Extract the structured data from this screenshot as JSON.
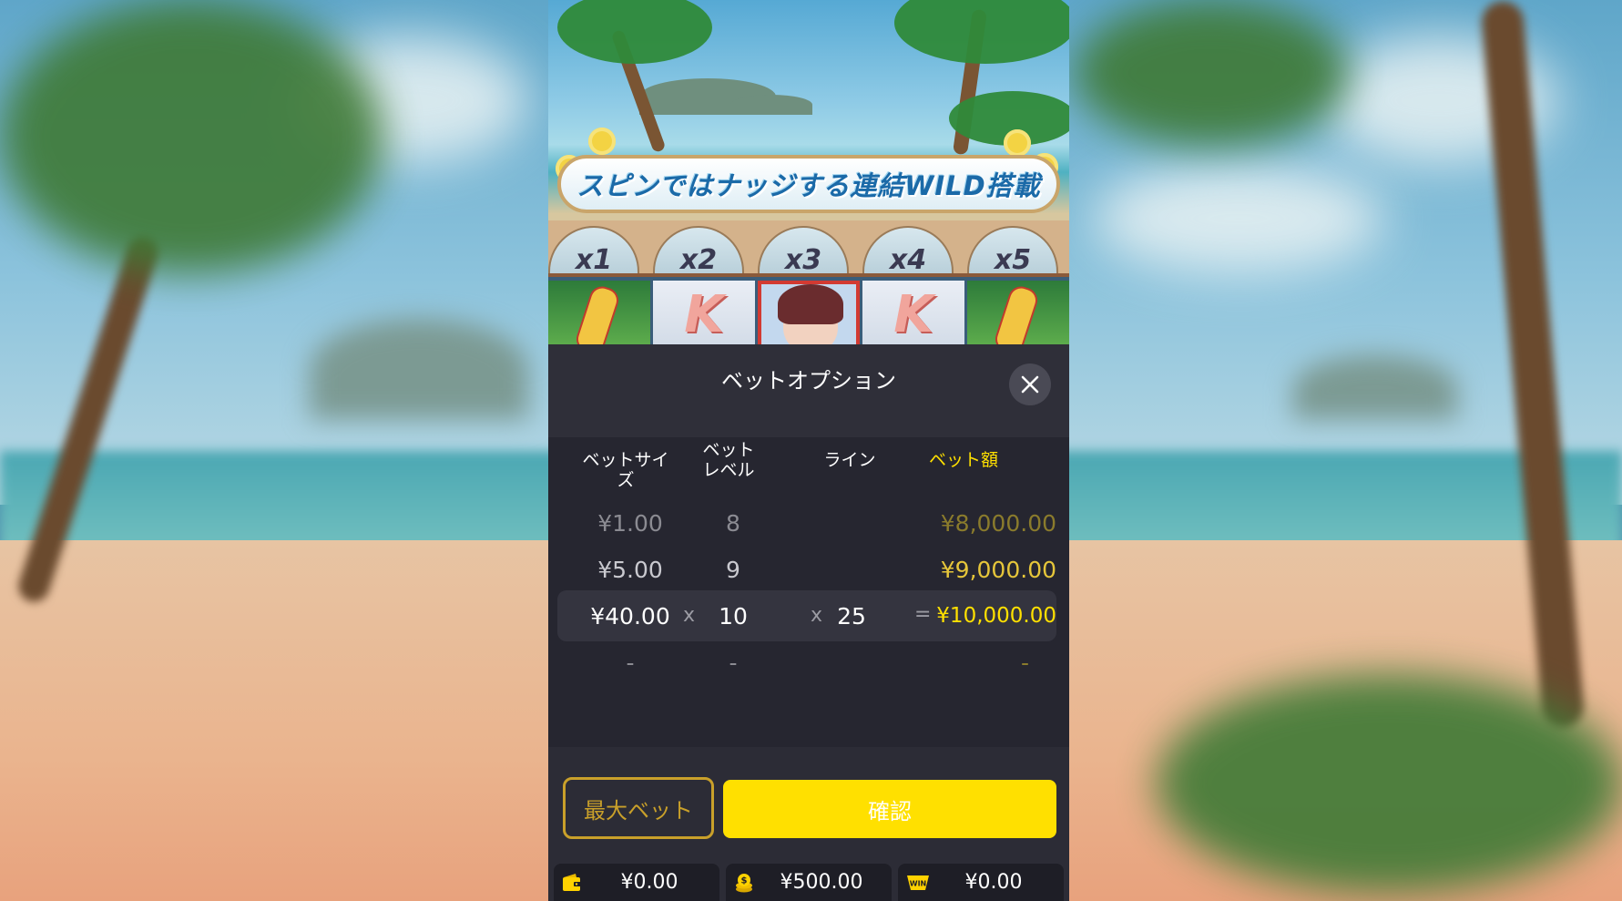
{
  "scene": {
    "banner_text": "スピンではナッジする連結WILD搭載",
    "multipliers": [
      "x1",
      "x2",
      "x3",
      "x4",
      "x5"
    ],
    "reel_letters": [
      "K",
      "K"
    ]
  },
  "panel": {
    "title": "ベットオプション",
    "columns": {
      "bet_size": "ベットサイズ",
      "bet_level_line1": "ベット",
      "bet_level_line2": "レベル",
      "lines": "ライン",
      "bet_amount": "ベット額"
    },
    "rows": [
      {
        "bet_size": "¥1.00",
        "bet_level": "8",
        "bet_amount": "¥8,000.00"
      },
      {
        "bet_size": "¥5.00",
        "bet_level": "9",
        "bet_amount": "¥9,000.00"
      }
    ],
    "selected": {
      "bet_size": "¥40.00",
      "bet_level": "10",
      "lines": "25",
      "bet_amount": "¥10,000.00",
      "op_multiply": "x",
      "op_equals": "="
    },
    "next_row": {
      "bet_size": "-",
      "bet_level": "-",
      "bet_amount": "-"
    },
    "max_bet_label": "最大ベット",
    "confirm_label": "確認"
  },
  "status_bar": {
    "bet": "¥0.00",
    "balance": "¥500.00",
    "win": "¥0.00",
    "win_icon_text": "WIN"
  },
  "colors": {
    "accent_yellow": "#ffe000",
    "gold_border": "#c9a02a",
    "panel_bg": "#2c2c36"
  },
  "icons": {
    "close": "close-icon",
    "bet": "wallet-icon",
    "balance": "coin-stack-icon",
    "win": "win-badge-icon"
  }
}
